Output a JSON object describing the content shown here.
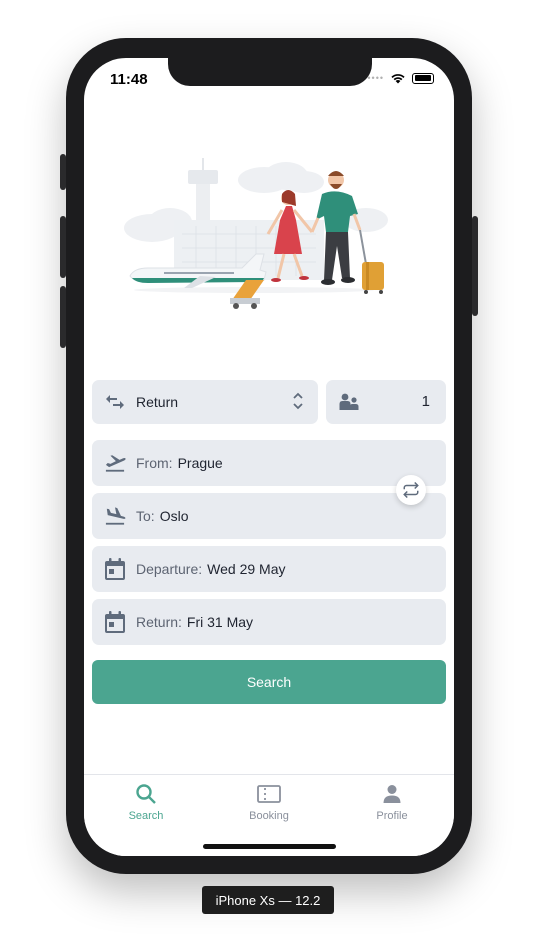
{
  "status_bar": {
    "time": "11:48"
  },
  "trip": {
    "type": "Return",
    "passengers": "1"
  },
  "from": {
    "label": "From:",
    "value": "Prague"
  },
  "to": {
    "label": "To:",
    "value": "Oslo"
  },
  "departure": {
    "label": "Departure:",
    "value": "Wed 29 May"
  },
  "return_date": {
    "label": "Return:",
    "value": "Fri 31 May"
  },
  "search_button": "Search",
  "tabs": [
    {
      "label": "Search",
      "icon": "search-icon",
      "active": true
    },
    {
      "label": "Booking",
      "icon": "ticket-icon",
      "active": false
    },
    {
      "label": "Profile",
      "icon": "person-icon",
      "active": false
    }
  ],
  "device_label": "iPhone Xs — 12.2",
  "colors": {
    "accent": "#4ba590",
    "field_bg": "#e8ebf0",
    "icon": "#5f6b7c",
    "inactive_tab": "#8a909c"
  }
}
